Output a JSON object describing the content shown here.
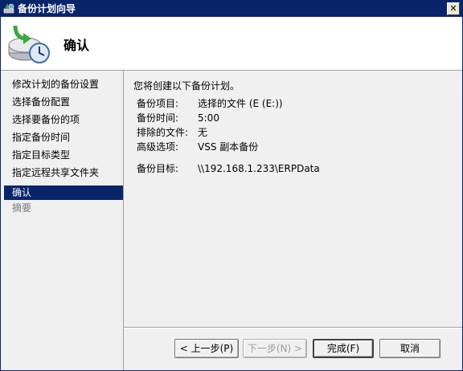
{
  "window": {
    "title": "备份计划向导",
    "close_glyph": "✕"
  },
  "header": {
    "title": "确认",
    "icon": "backup-clock-icon"
  },
  "sidebar": {
    "items": [
      {
        "label": "修改计划的备份设置",
        "state": "normal"
      },
      {
        "label": "选择备份配置",
        "state": "normal"
      },
      {
        "label": "选择要备份的项",
        "state": "normal"
      },
      {
        "label": "指定备份时间",
        "state": "normal"
      },
      {
        "label": "指定目标类型",
        "state": "normal"
      },
      {
        "label": "指定远程共享文件夹",
        "state": "normal"
      },
      {
        "label": "确认",
        "state": "active"
      },
      {
        "label": "摘要",
        "state": "disabled"
      }
    ]
  },
  "main": {
    "intro": "您将创建以下备份计划。",
    "details": [
      {
        "label": "备份项目:",
        "value": "选择的文件 (E (E:))"
      },
      {
        "label": "备份时间:",
        "value": "5:00"
      },
      {
        "label": "排除的文件:",
        "value": "无"
      },
      {
        "label": "高级选项:",
        "value": "VSS 副本备份"
      }
    ],
    "target": {
      "label": "备份目标:",
      "value": "\\\\192.168.1.233\\ERPData"
    }
  },
  "buttons": {
    "prev": "< 上一步(P)",
    "next": "下一步(N) >",
    "finish": "完成(F)",
    "cancel": "取消"
  },
  "colors": {
    "titlebar": "#0a246a",
    "selection": "#0a246a"
  }
}
